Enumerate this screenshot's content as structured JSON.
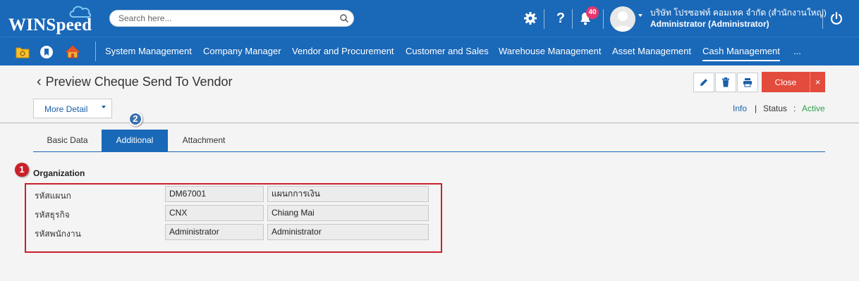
{
  "app": {
    "logo_text": "WINSpeed",
    "search_placeholder": "Search here...",
    "notifications_count": "40",
    "user_company": "บริษัท โปรซอฟท์ คอมเทค จำกัด (สำนักงานใหญ่)",
    "user_role": "Administrator (Administrator)"
  },
  "nav": {
    "items": [
      {
        "label": "System Management"
      },
      {
        "label": "Company Manager"
      },
      {
        "label": "Vendor and Procurement"
      },
      {
        "label": "Customer and Sales"
      },
      {
        "label": "Warehouse Management"
      },
      {
        "label": "Asset Management"
      },
      {
        "label": "Cash Management"
      },
      {
        "label": "..."
      }
    ],
    "active": "Cash Management"
  },
  "page": {
    "title": "Preview Cheque Send To Vendor",
    "more_detail": "More Detail",
    "close_label": "Close",
    "close_x": "×",
    "info_label": "Info",
    "info_sep": "|",
    "status_label": "Status",
    "status_colon": ":",
    "status_value": "Active"
  },
  "tabs": [
    {
      "label": "Basic Data"
    },
    {
      "label": "Additional"
    },
    {
      "label": "Attachment"
    }
  ],
  "markers": {
    "one": "1",
    "two": "2"
  },
  "organization": {
    "title": "Organization",
    "rows": [
      {
        "label": "รหัสแผนก",
        "code": "DM67001",
        "name": "แผนกการเงิน"
      },
      {
        "label": "รหัสธุรกิจ",
        "code": "CNX",
        "name": "Chiang Mai"
      },
      {
        "label": "รหัสพนักงาน",
        "code": "Administrator",
        "name": "Administrator"
      }
    ]
  },
  "colors": {
    "primary": "#1a68b8",
    "danger": "#e34b3c",
    "status_active": "#2e9e4a",
    "marker_red": "#c8212a"
  }
}
